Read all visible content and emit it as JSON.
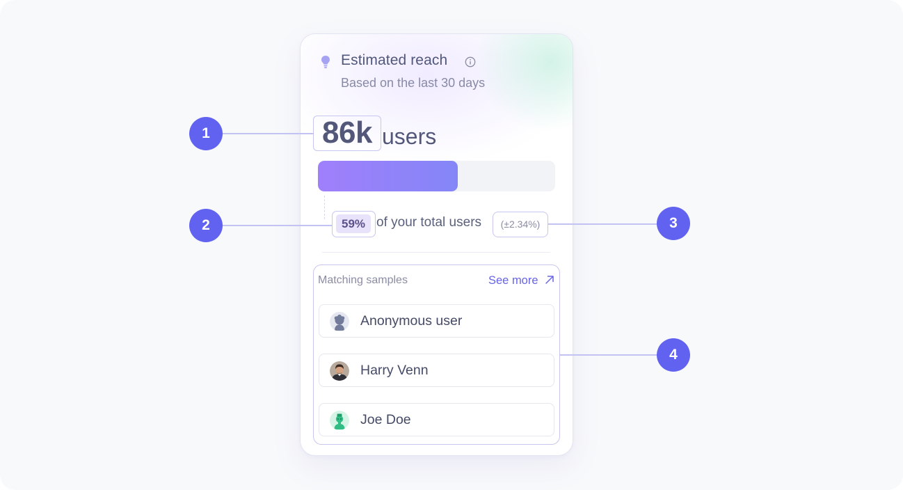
{
  "colors": {
    "accent": "#6262f1",
    "highlight_border": "#c6c6f0",
    "progress_start": "#a07ffb",
    "progress_end": "#8486f7",
    "text_primary": "#53587a",
    "text_muted": "#878aa6"
  },
  "card": {
    "icon": "lightbulb-icon",
    "title": "Estimated reach",
    "info_icon": "info-circle-icon",
    "subtitle": "Based on the last 30 days",
    "reach_value": "86k",
    "reach_unit": "users",
    "progress_fraction": 0.59,
    "percent_label": "59%",
    "percent_text": "of your total users",
    "margin_of_error": "(±2.34%)"
  },
  "samples": {
    "label": "Matching samples",
    "see_more": "See more",
    "see_more_icon": "arrow-up-right-icon",
    "items": [
      {
        "name": "Anonymous user",
        "avatar": "anonymous-avatar-icon"
      },
      {
        "name": "Harry Venn",
        "avatar": "photo-avatar"
      },
      {
        "name": "Joe Doe",
        "avatar": "green-character-avatar"
      }
    ]
  },
  "annotations": {
    "markers": [
      "1",
      "2",
      "3",
      "4"
    ]
  }
}
